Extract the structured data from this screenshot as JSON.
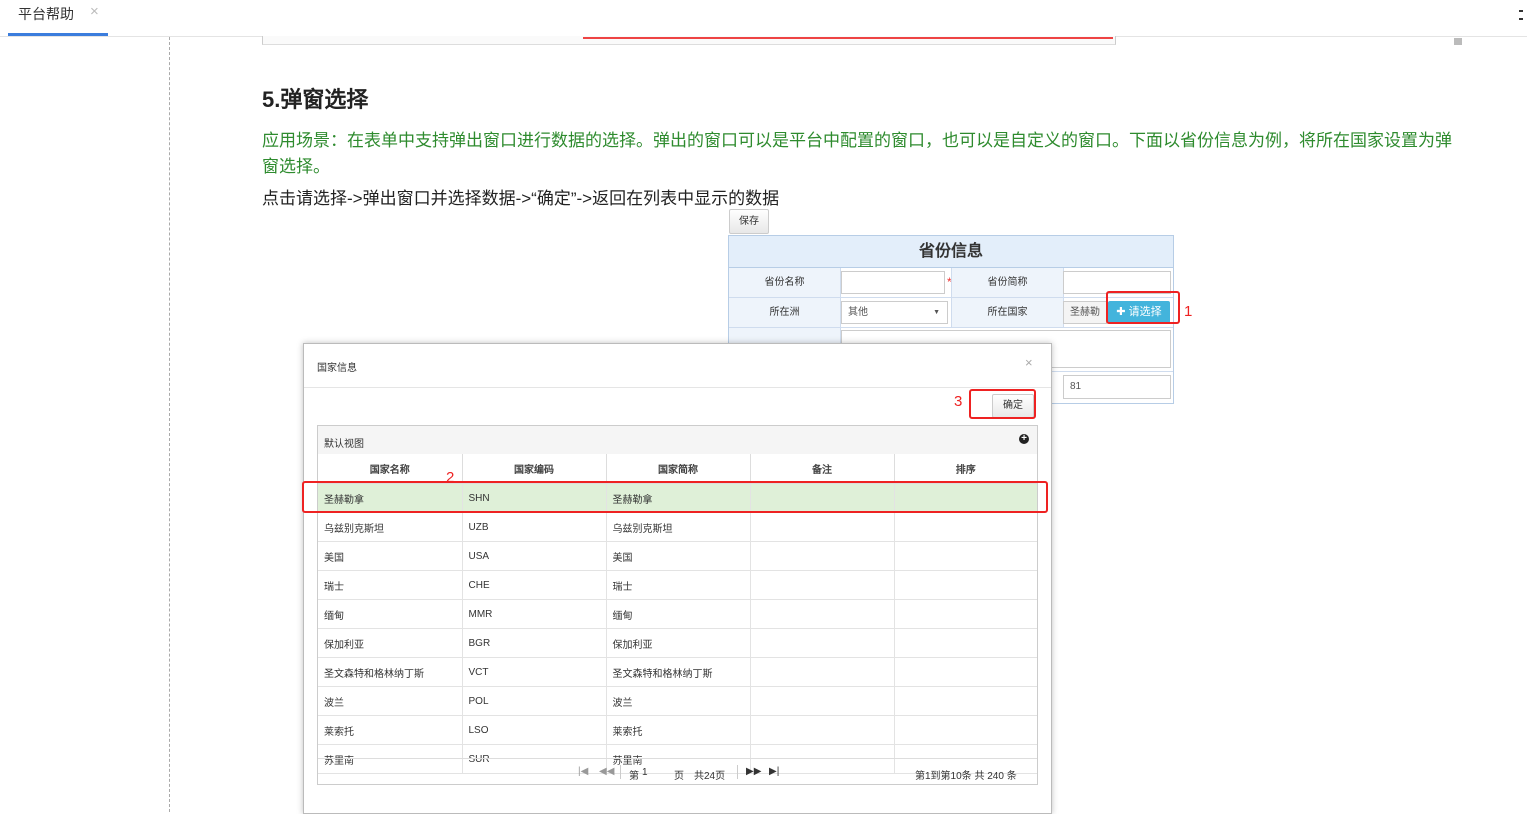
{
  "tabs": [
    {
      "label": "平台帮助",
      "close": "×"
    }
  ],
  "doc": {
    "heading": "5.弹窗选择",
    "scenario": "应用场景：在表单中支持弹出窗口进行数据的选择。弹出的窗口可以是平台中配置的窗口，也可以是自定义的窗口。下面以省份信息为例，将所在国家设置为弹窗选择。",
    "steps": "点击请选择->弹出窗口并选择数据->“确定”->返回在列表中显示的数据"
  },
  "form": {
    "save_label": "保存",
    "title": "省份信息",
    "province_name_label": "省份名称",
    "required_mark": "*",
    "province_short_label": "省份简称",
    "continent_label": "所在洲",
    "continent_value": "其他",
    "country_label": "所在国家",
    "country_value": "圣赫勒",
    "pick_label": "请选择",
    "sort_value": "81"
  },
  "annotations": {
    "n1": "1",
    "n2": "2",
    "n3": "3"
  },
  "modal": {
    "title": "国家信息",
    "close": "×",
    "ok_label": "确定",
    "view_label": "默认视图",
    "columns": [
      "国家名称",
      "国家编码",
      "国家简称",
      "备注",
      "排序"
    ],
    "rows": [
      [
        "圣赫勒拿",
        "SHN",
        "圣赫勒拿",
        "",
        ""
      ],
      [
        "乌兹别克斯坦",
        "UZB",
        "乌兹别克斯坦",
        "",
        ""
      ],
      [
        "美国",
        "USA",
        "美国",
        "",
        ""
      ],
      [
        "瑞士",
        "CHE",
        "瑞士",
        "",
        ""
      ],
      [
        "缅甸",
        "MMR",
        "缅甸",
        "",
        ""
      ],
      [
        "保加利亚",
        "BGR",
        "保加利亚",
        "",
        ""
      ],
      [
        "圣文森特和格林纳丁斯",
        "VCT",
        "圣文森特和格林纳丁斯",
        "",
        ""
      ],
      [
        "波兰",
        "POL",
        "波兰",
        "",
        ""
      ],
      [
        "莱索托",
        "LSO",
        "莱索托",
        "",
        ""
      ],
      [
        "苏里南",
        "SUR",
        "苏里南",
        "",
        ""
      ]
    ],
    "selected_row": 0,
    "pager": {
      "page_prefix": "第",
      "page_value": "1",
      "page_suffix": "页",
      "total_pages": "共24页",
      "summary": "第1到第10条  共 240 条"
    }
  },
  "colors": {
    "accent": "#3b7ddd",
    "annotation": "#e22222",
    "selected_row": "#dff0d8",
    "pick_button": "#43b4dc",
    "scenario_text": "#2e8b2e"
  }
}
